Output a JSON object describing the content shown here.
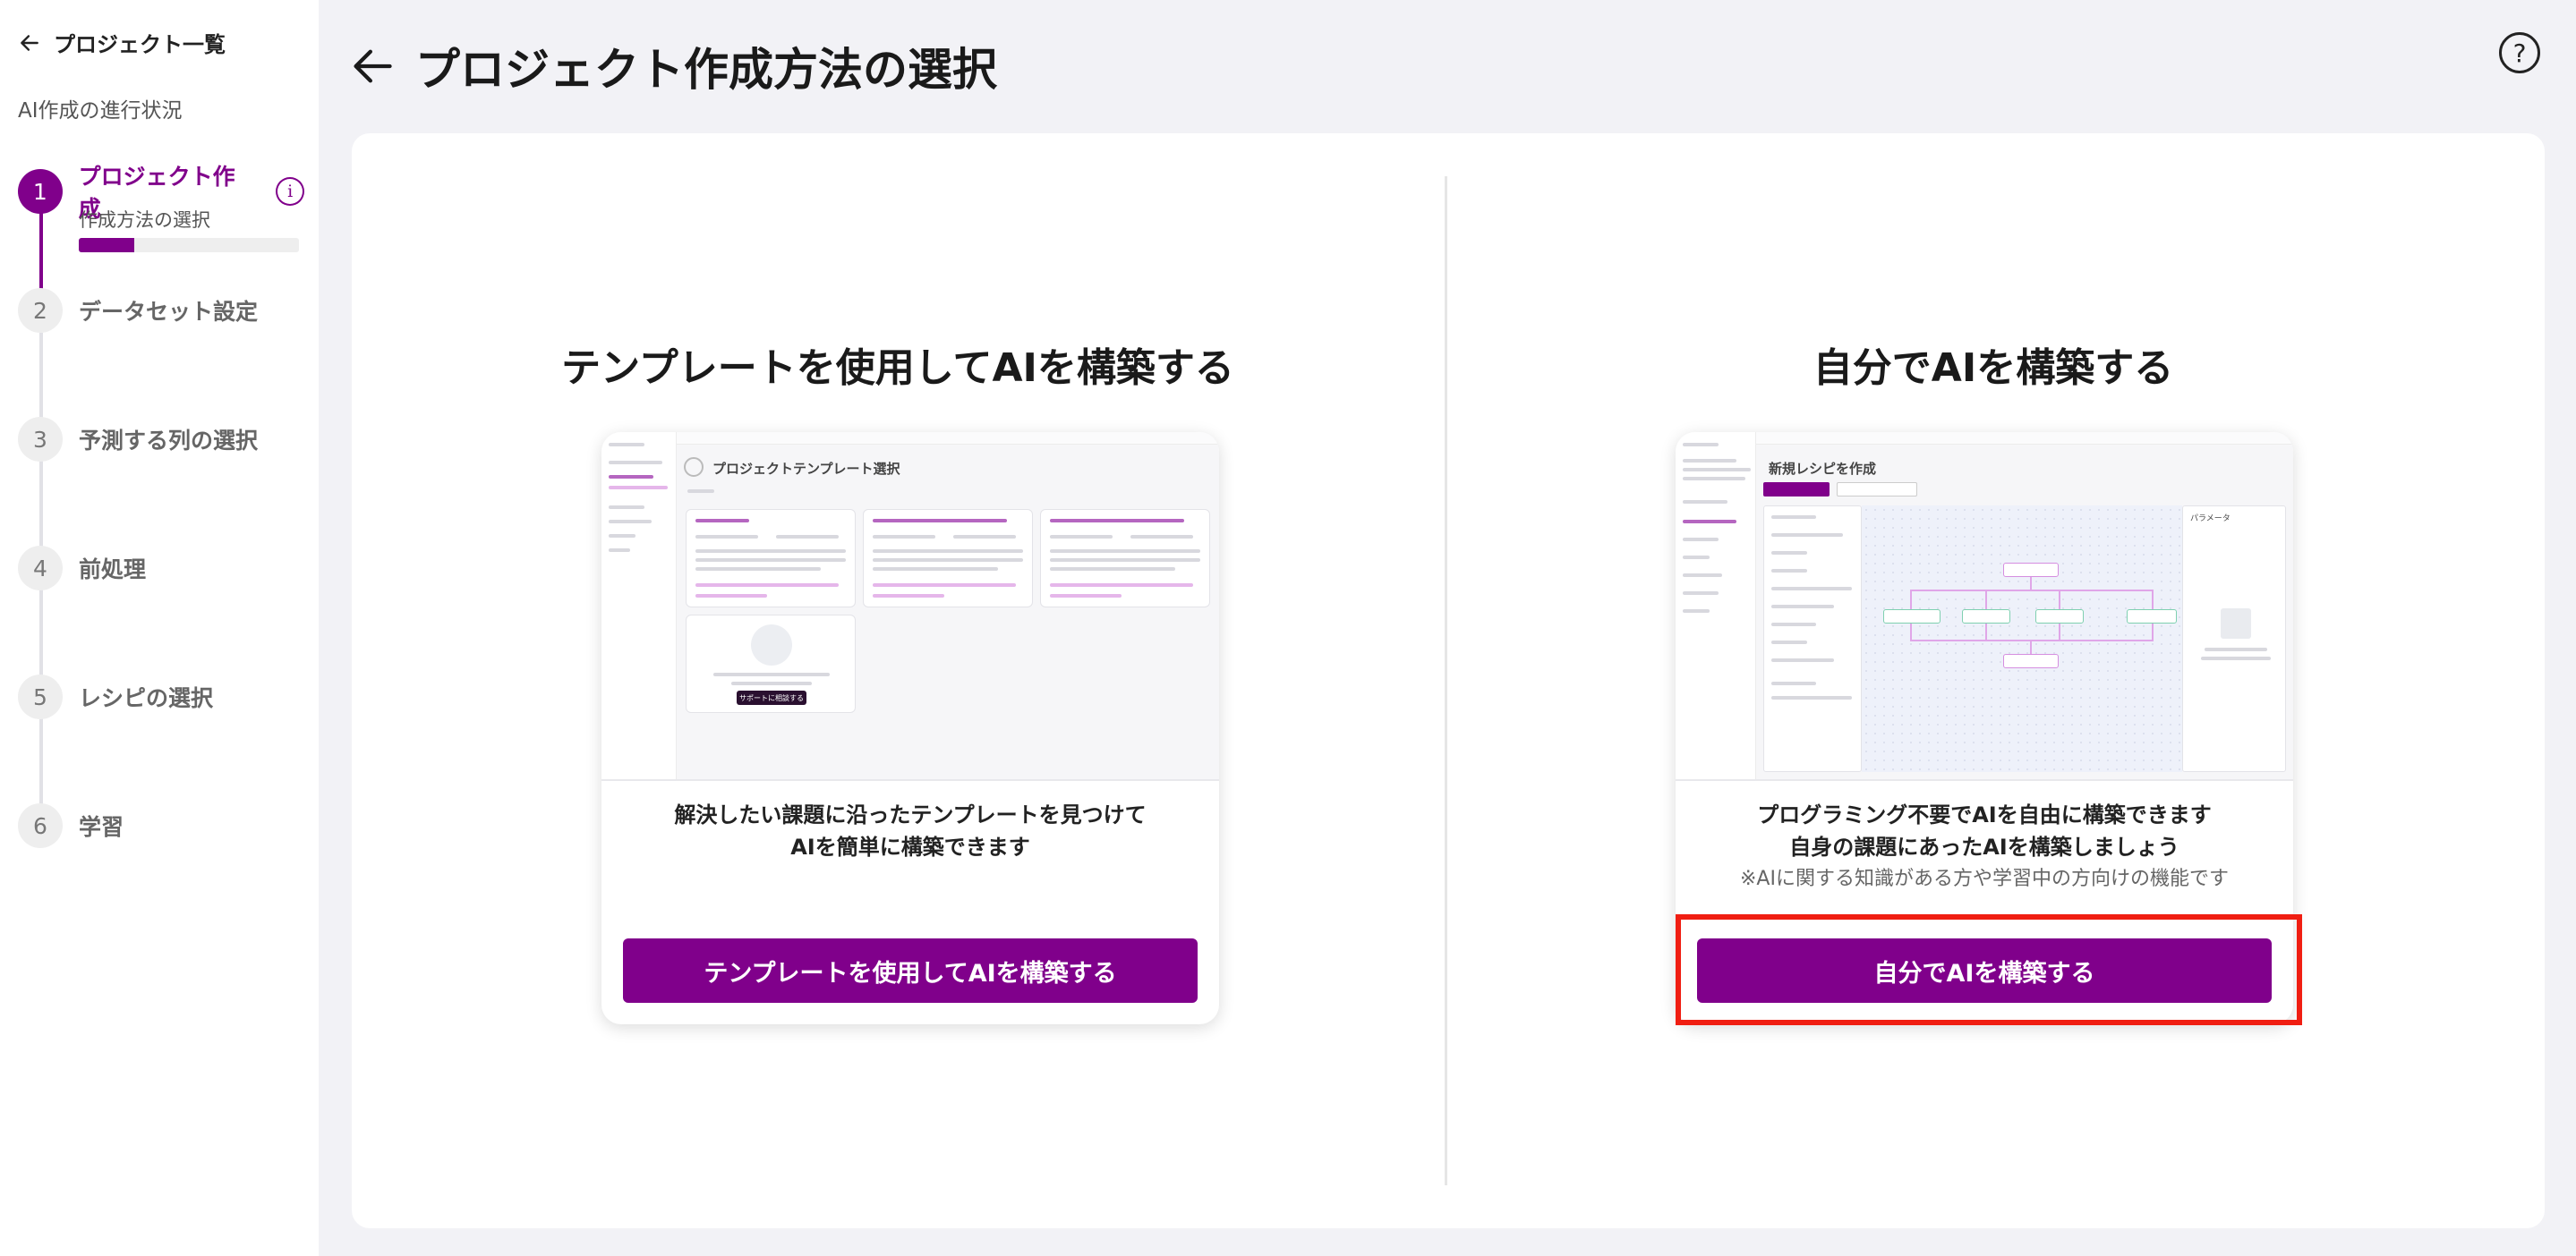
{
  "sidebar": {
    "back_label": "プロジェクト一覧",
    "progress_title": "AI作成の進行状況",
    "steps": [
      {
        "num": "1",
        "label": "プロジェクト作成",
        "sub_label": "作成方法の選択",
        "progress": 0.25
      },
      {
        "num": "2",
        "label": "データセット設定"
      },
      {
        "num": "3",
        "label": "予測する列の選択"
      },
      {
        "num": "4",
        "label": "前処理"
      },
      {
        "num": "5",
        "label": "レシピの選択"
      },
      {
        "num": "6",
        "label": "学習"
      }
    ]
  },
  "header": {
    "title": "プロジェクト作成方法の選択",
    "help_glyph": "?"
  },
  "options": {
    "template": {
      "title": "テンプレートを使用してAIを構築する",
      "desc_line1": "解決したい課題に沿ったテンプレートを見つけて",
      "desc_line2": "AIを簡単に構築できます",
      "button": "テンプレートを使用してAIを構築する",
      "preview": {
        "heading": "プロジェクトテンプレート選択",
        "empty_button": "サポートに相談する"
      }
    },
    "custom": {
      "title": "自分でAIを構築する",
      "desc_line1": "プログラミング不要でAIを自由に構築できます",
      "desc_line2": "自身の課題にあったAIを構築しましょう",
      "note": "※AIに関する知識がある方や学習中の方向けの機能です",
      "button": "自分でAIを構築する",
      "preview": {
        "heading": "新規レシピを作成",
        "panel_label": "パラメータ"
      }
    }
  },
  "colors": {
    "accent": "#80008b",
    "highlight": "#f01e12"
  }
}
